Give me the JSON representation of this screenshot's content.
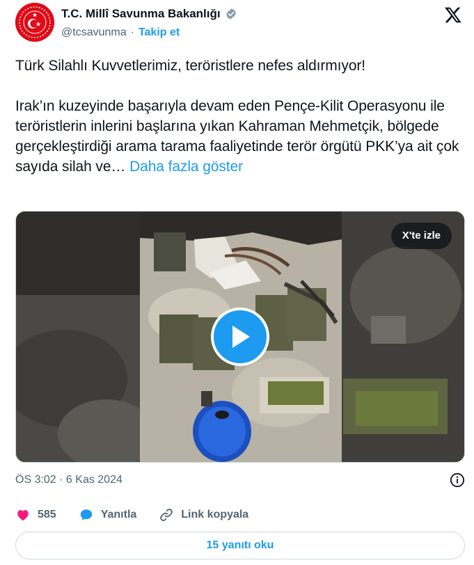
{
  "account": {
    "name": "T.C. Millî Savunma Bakanlığı",
    "handle": "@tcsavunma",
    "separator": "·",
    "follow_label": "Takip et"
  },
  "tweet": {
    "line1": "Türk Silahlı Kuvvetlerimiz, teröristlere nefes aldırmıyor!",
    "body": "Irak’ın kuzeyinde başarıyla devam eden Pençe-Kilit Operasyonu ile teröristlerin inlerini başlarına yıkan Kahraman Mehmetçik, bölgede gerçekleştirdiği arama tarama faaliyetinde terör örgütü PKK’ya ait çok sayıda silah ve…",
    "show_more": "Daha fazla göster"
  },
  "media": {
    "watch_label": "X'te izle"
  },
  "meta": {
    "timestamp": "ÖS 3:02 · 6 Kas 2024"
  },
  "actions": {
    "like_count": "585",
    "reply_label": "Yanıtla",
    "copy_link_label": "Link kopyala"
  },
  "replies": {
    "label": "15 yanıtı oku"
  },
  "colors": {
    "accent": "#1d9bf0",
    "like": "#f91880",
    "secondary_text": "#536471",
    "avatar_red": "#e30a17"
  },
  "icons": [
    "verified-badge-icon",
    "x-logo-icon",
    "play-icon",
    "info-icon",
    "heart-icon",
    "reply-bubble-icon",
    "link-icon"
  ]
}
